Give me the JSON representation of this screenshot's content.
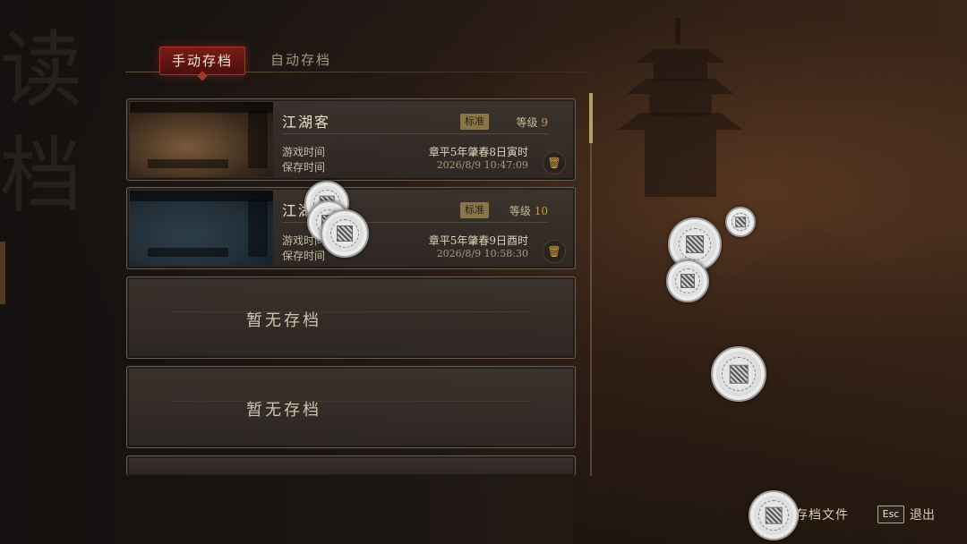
{
  "background": {
    "watermark_chars": [
      "读",
      "档"
    ]
  },
  "tabs": [
    {
      "label": "手动存档",
      "active": true
    },
    {
      "label": "自动存档",
      "active": false
    }
  ],
  "slots": [
    {
      "name": "江湖客",
      "difficulty": "标准",
      "level_label": "等级",
      "level": "9",
      "play_time_label": "游戏时间",
      "save_time_label": "保存时间",
      "game_date": "章平5年肇春8日寅时",
      "save_date": "2026/8/9 10:47:09"
    },
    {
      "name": "江湖客",
      "difficulty": "标准",
      "level_label": "等级",
      "level": "10",
      "play_time_label": "游戏时间",
      "save_time_label": "保存时间",
      "game_date": "章平5年肇春9日酉时",
      "save_date": "2026/8/9 10:58:30"
    },
    {
      "empty_label": "暂无存档"
    },
    {
      "empty_label": "暂无存档"
    }
  ],
  "footer": {
    "file_label": "存档文件",
    "esc_key": "Esc",
    "exit_label": "退出"
  },
  "icons": {
    "delete": "trash-icon",
    "coin": "copper-coin-icon"
  },
  "colors": {
    "active_tab": "#7a1c16",
    "badge": "#8a7548",
    "level_number": "#c99a4b",
    "delete_icon": "#d4a24a"
  }
}
